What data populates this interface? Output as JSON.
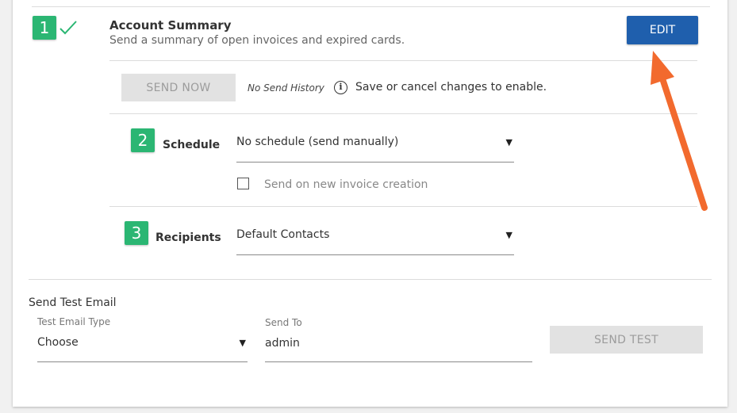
{
  "account_summary": {
    "step": "1",
    "title": "Account Summary",
    "subtitle": "Send a summary of open invoices and expired cards.",
    "edit_label": "EDIT"
  },
  "send_row": {
    "send_now_label": "SEND NOW",
    "history_text": "No Send History",
    "info_text": "Save or cancel changes to enable."
  },
  "schedule": {
    "step": "2",
    "label": "Schedule",
    "selected": "No schedule (send manually)",
    "checkbox_label": "Send on new invoice creation",
    "checkbox_checked": false
  },
  "recipients": {
    "step": "3",
    "label": "Recipients",
    "selected": "Default Contacts"
  },
  "test_email": {
    "heading": "Send Test Email",
    "type_label": "Test Email Type",
    "type_value": "Choose",
    "send_to_label": "Send To",
    "send_to_value": "admin",
    "send_test_label": "SEND TEST"
  },
  "colors": {
    "step_badge": "#2bb673",
    "checkmark": "#2bb673",
    "edit_button": "#1f5fad",
    "arrow": "#f26a2e"
  },
  "icons": {
    "check": "check-icon",
    "info": "info-icon",
    "caret": "caret-down-icon"
  }
}
